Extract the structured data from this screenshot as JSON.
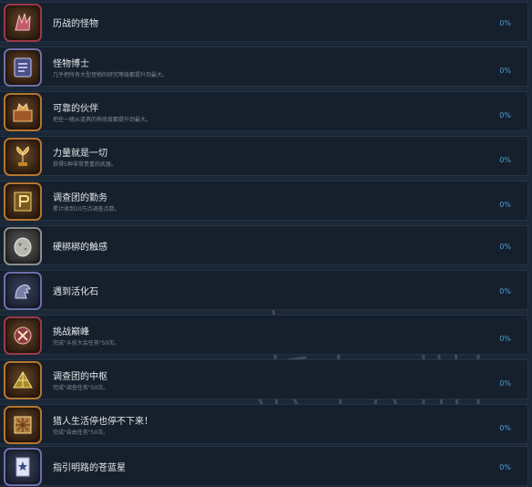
{
  "achievements": [
    {
      "title": "历战的怪物",
      "desc": "",
      "percent": "0%",
      "icon": "monster-claw-icon",
      "border": "#9a3a4a"
    },
    {
      "title": "怪物博士",
      "desc": "几乎把所有大型怪物的研究等级都提升到最大。",
      "percent": "0%",
      "icon": "monster-book-icon",
      "border": "#6d6fa8"
    },
    {
      "title": "可靠的伙伴",
      "desc": "把任一随从道具的熟练度都提升到最大。",
      "percent": "0%",
      "icon": "palico-chest-icon",
      "border": "#b5762f"
    },
    {
      "title": "力量就是一切",
      "desc": "获得5种非常贵重的武器。",
      "percent": "0%",
      "icon": "golden-fleur-icon",
      "border": "#b5762f"
    },
    {
      "title": "调查团的勤务",
      "desc": "累计收到10万点调查点数。",
      "percent": "0%",
      "icon": "research-points-icon",
      "border": "#b5762f"
    },
    {
      "title": "硬梆梆的触感",
      "desc": "",
      "percent": "0%",
      "icon": "stone-egg-icon",
      "border": "#8c8c8c"
    },
    {
      "title": "遇到活化石",
      "desc": "",
      "percent": "0%",
      "icon": "fossil-creature-icon",
      "border": "#6d6fa8"
    },
    {
      "title": "挑战巅峰",
      "desc": "完成\"斗技大会任务\"50次。",
      "percent": "0%",
      "icon": "arena-crest-icon",
      "border": "#9a3a4a"
    },
    {
      "title": "调查团的中枢",
      "desc": "完成\"调查任务\"50次。",
      "percent": "0%",
      "icon": "camp-tent-icon",
      "border": "#b5762f"
    },
    {
      "title": "猎人生活停也停不下来！",
      "desc": "完成\"自由任务\"50次。",
      "percent": "0%",
      "icon": "quest-map-icon",
      "border": "#b5762f"
    },
    {
      "title": "指引明路的苍蓝星",
      "desc": "",
      "percent": "0%",
      "icon": "blue-star-emblem-icon",
      "border": "#6d6fa8"
    }
  ]
}
